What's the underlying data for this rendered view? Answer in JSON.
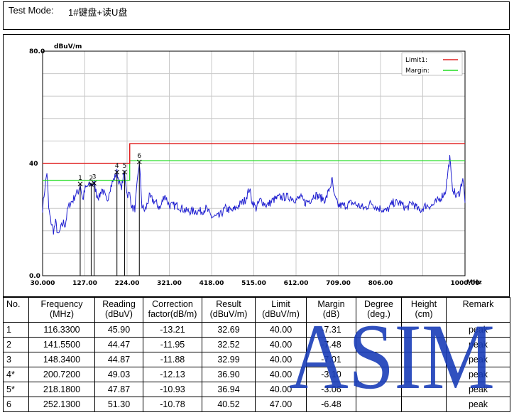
{
  "test_mode": {
    "label": "Test Mode:",
    "value": "1#键盘+读U盘"
  },
  "chart_data": {
    "type": "line",
    "ylabel": "dBuV/m",
    "xunit": "MHz",
    "ylim": [
      0,
      80
    ],
    "xlim": [
      30,
      1000
    ],
    "ytick_labels": [
      {
        "value": 80,
        "label": "80.0"
      },
      {
        "value": 40,
        "label": "40"
      },
      {
        "value": 0,
        "label": "0.0"
      }
    ],
    "xtick_labels": [
      "30.000",
      "127.00",
      "224.00",
      "321.00",
      "418.00",
      "515.00",
      "612.00",
      "709.00",
      "806.00",
      "1000.00"
    ],
    "xtick_values": [
      30,
      127,
      224,
      321,
      418,
      515,
      612,
      709,
      806,
      1000
    ],
    "grid": true,
    "legend": {
      "position": "top-right",
      "entries": [
        {
          "label": "Limit1:",
          "color": "#e02020"
        },
        {
          "label": "Margin:",
          "color": "#22dd22"
        }
      ]
    },
    "limit_line": {
      "color": "#e02020",
      "points": [
        [
          30,
          40
        ],
        [
          230,
          40
        ],
        [
          230,
          47
        ],
        [
          1000,
          47
        ]
      ]
    },
    "margin_line": {
      "color": "#22dd22",
      "points": [
        [
          30,
          34
        ],
        [
          230,
          34
        ],
        [
          230,
          41
        ],
        [
          1000,
          41
        ]
      ]
    },
    "trace_color": "#2020d0",
    "trace_anchors": [
      [
        30,
        24
      ],
      [
        35,
        31
      ],
      [
        40,
        37
      ],
      [
        44,
        24
      ],
      [
        48,
        20
      ],
      [
        55,
        16
      ],
      [
        60,
        19
      ],
      [
        66,
        14
      ],
      [
        72,
        17
      ],
      [
        78,
        19
      ],
      [
        82,
        18
      ],
      [
        88,
        24
      ],
      [
        94,
        26
      ],
      [
        100,
        27
      ],
      [
        106,
        29
      ],
      [
        112,
        30
      ],
      [
        116.33,
        32.7
      ],
      [
        122,
        27
      ],
      [
        128,
        31
      ],
      [
        134,
        32
      ],
      [
        141.55,
        32.5
      ],
      [
        148.34,
        33
      ],
      [
        154,
        29
      ],
      [
        160,
        28
      ],
      [
        166,
        31
      ],
      [
        172,
        29
      ],
      [
        178,
        26
      ],
      [
        184,
        31
      ],
      [
        190,
        33
      ],
      [
        200.72,
        36.9
      ],
      [
        205,
        34
      ],
      [
        210,
        31
      ],
      [
        218.18,
        36.9
      ],
      [
        224,
        29
      ],
      [
        230,
        29
      ],
      [
        236,
        24
      ],
      [
        242,
        24
      ],
      [
        252.13,
        40.5
      ],
      [
        258,
        25
      ],
      [
        265,
        23
      ],
      [
        275,
        28
      ],
      [
        290,
        26
      ],
      [
        300,
        24
      ],
      [
        310,
        29
      ],
      [
        321,
        25
      ],
      [
        340,
        25
      ],
      [
        360,
        23
      ],
      [
        380,
        23
      ],
      [
        395,
        23
      ],
      [
        405,
        24
      ],
      [
        418,
        21
      ],
      [
        435,
        21
      ],
      [
        450,
        24
      ],
      [
        465,
        23
      ],
      [
        480,
        25
      ],
      [
        495,
        27
      ],
      [
        505,
        31
      ],
      [
        510,
        27
      ],
      [
        520,
        24
      ],
      [
        530,
        27
      ],
      [
        545,
        25
      ],
      [
        560,
        27
      ],
      [
        575,
        28
      ],
      [
        590,
        28
      ],
      [
        600,
        28
      ],
      [
        612,
        27
      ],
      [
        622,
        28
      ],
      [
        632,
        26
      ],
      [
        645,
        27
      ],
      [
        655,
        29
      ],
      [
        665,
        28
      ],
      [
        680,
        27
      ],
      [
        695,
        34
      ],
      [
        700,
        28
      ],
      [
        709,
        25
      ],
      [
        725,
        25
      ],
      [
        740,
        26
      ],
      [
        755,
        25
      ],
      [
        770,
        24
      ],
      [
        785,
        26
      ],
      [
        800,
        24
      ],
      [
        806,
        24
      ],
      [
        820,
        23
      ],
      [
        835,
        26
      ],
      [
        850,
        26
      ],
      [
        865,
        24
      ],
      [
        880,
        26
      ],
      [
        895,
        23
      ],
      [
        910,
        25
      ],
      [
        925,
        25
      ],
      [
        940,
        27
      ],
      [
        955,
        30
      ],
      [
        965,
        42
      ],
      [
        970,
        32
      ],
      [
        980,
        28
      ],
      [
        988,
        30
      ],
      [
        995,
        35
      ],
      [
        1000,
        26
      ]
    ],
    "markers": [
      {
        "label": "1",
        "freq": 116.33,
        "level": 32.69
      },
      {
        "label": "2",
        "freq": 141.55,
        "level": 32.52
      },
      {
        "label": "3",
        "freq": 148.34,
        "level": 32.99
      },
      {
        "label": "4",
        "freq": 200.72,
        "level": 36.9
      },
      {
        "label": "5",
        "freq": 218.18,
        "level": 36.94
      },
      {
        "label": "6",
        "freq": 252.13,
        "level": 40.52
      }
    ]
  },
  "table": {
    "headers": [
      {
        "line1": "No.",
        "line2": ""
      },
      {
        "line1": "Frequency",
        "line2": "(MHz)"
      },
      {
        "line1": "Reading",
        "line2": "(dBuV)"
      },
      {
        "line1": "Correction",
        "line2": "factor(dB/m)"
      },
      {
        "line1": "Result",
        "line2": "(dBuV/m)"
      },
      {
        "line1": "Limit",
        "line2": "(dBuV/m)"
      },
      {
        "line1": "Margin",
        "line2": "(dB)"
      },
      {
        "line1": "Degree",
        "line2": "(deg.)"
      },
      {
        "line1": "Height",
        "line2": "(cm)"
      },
      {
        "line1": "Remark",
        "line2": ""
      }
    ],
    "rows": [
      {
        "no": "1",
        "freq": "116.3300",
        "reading": "45.90",
        "corr": "-13.21",
        "result": "32.69",
        "limit": "40.00",
        "margin": "-7.31",
        "degree": "",
        "height": "",
        "remark": "peak"
      },
      {
        "no": "2",
        "freq": "141.5500",
        "reading": "44.47",
        "corr": "-11.95",
        "result": "32.52",
        "limit": "40.00",
        "margin": "-7.48",
        "degree": "",
        "height": "",
        "remark": "peak"
      },
      {
        "no": "3",
        "freq": "148.3400",
        "reading": "44.87",
        "corr": "-11.88",
        "result": "32.99",
        "limit": "40.00",
        "margin": "-7.01",
        "degree": "",
        "height": "",
        "remark": "peak"
      },
      {
        "no": "4*",
        "freq": "200.7200",
        "reading": "49.03",
        "corr": "-12.13",
        "result": "36.90",
        "limit": "40.00",
        "margin": "-3.10",
        "degree": "",
        "height": "",
        "remark": "peak"
      },
      {
        "no": "5*",
        "freq": "218.1800",
        "reading": "47.87",
        "corr": "-10.93",
        "result": "36.94",
        "limit": "40.00",
        "margin": "-3.06",
        "degree": "",
        "height": "",
        "remark": "peak"
      },
      {
        "no": "6",
        "freq": "252.1300",
        "reading": "51.30",
        "corr": "-10.78",
        "result": "40.52",
        "limit": "47.00",
        "margin": "-6.48",
        "degree": "",
        "height": "",
        "remark": "peak"
      }
    ]
  },
  "watermark": {
    "text": "ASIM",
    "color": "#1a3db8"
  }
}
